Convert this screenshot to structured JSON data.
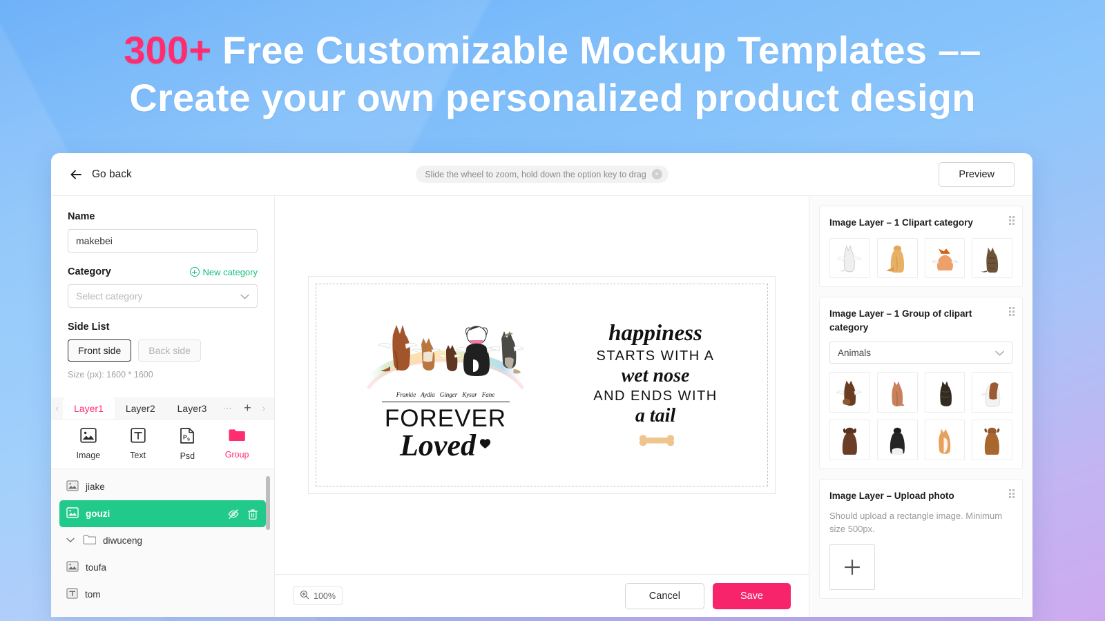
{
  "banner": {
    "count": "300+",
    "line1_rest": " Free Customizable Mockup Templates ––",
    "line2": "Create your own personalized product design"
  },
  "header": {
    "back_label": "Go back",
    "hint": "Slide the wheel to zoom, hold down the option key to drag",
    "hint_close": "×",
    "preview_label": "Preview"
  },
  "left_panel": {
    "name_label": "Name",
    "name_value": "makebei",
    "category_label": "Category",
    "new_category_label": "New category",
    "category_placeholder": "Select category",
    "side_list_label": "Side List",
    "front_side_label": "Front side",
    "back_side_label": "Back side",
    "size_note": "Size (px): 1600 * 1600",
    "tabs": [
      {
        "label": "Layer1",
        "active": true
      },
      {
        "label": "Layer2",
        "active": false
      },
      {
        "label": "Layer3",
        "active": false
      }
    ],
    "tab_more": "⋯",
    "tab_add": "+",
    "tab_prev": "‹",
    "tab_next": "›",
    "add_types": [
      {
        "label": "Image",
        "icon": "image-icon"
      },
      {
        "label": "Text",
        "icon": "text-icon"
      },
      {
        "label": "Psd",
        "icon": "psd-icon"
      },
      {
        "label": "Group",
        "icon": "folder-icon"
      }
    ],
    "layers": [
      {
        "name": "jiake",
        "type": "image",
        "selected": false
      },
      {
        "name": "gouzi",
        "type": "image",
        "selected": true
      },
      {
        "name": "diwuceng",
        "type": "group",
        "selected": false
      },
      {
        "name": "toufa",
        "type": "image",
        "selected": false
      },
      {
        "name": "tom",
        "type": "text",
        "selected": false
      }
    ]
  },
  "canvas": {
    "art": {
      "pet_names": [
        "Frankie",
        "Aydia",
        "Ginger",
        "Kysar",
        "Fane"
      ],
      "forever": "FOREVER",
      "loved": "Loved",
      "quote_line1": "happiness",
      "quote_line2": "STARTS WITH A",
      "quote_line3": "wet nose",
      "quote_line4": "AND ENDS WITH",
      "quote_line5": "a tail"
    }
  },
  "bottom_bar": {
    "zoom_level": "100%",
    "cancel_label": "Cancel",
    "save_label": "Save"
  },
  "right_panel": {
    "cards": [
      {
        "title": "Image Layer – 1 Clipart category"
      },
      {
        "title": "Image Layer – 1 Group of clipart category",
        "select_value": "Animals"
      },
      {
        "title": "Image Layer – Upload photo",
        "note": "Should upload a rectangle image. Minimum size 500px.",
        "upload_plus": "+"
      }
    ]
  },
  "colors": {
    "accent_pink": "#ff2d6f",
    "save_pink": "#f7246c",
    "selected_green": "#21c98a",
    "link_green": "#15c07c",
    "banner_blue": "#8cc6fb"
  }
}
